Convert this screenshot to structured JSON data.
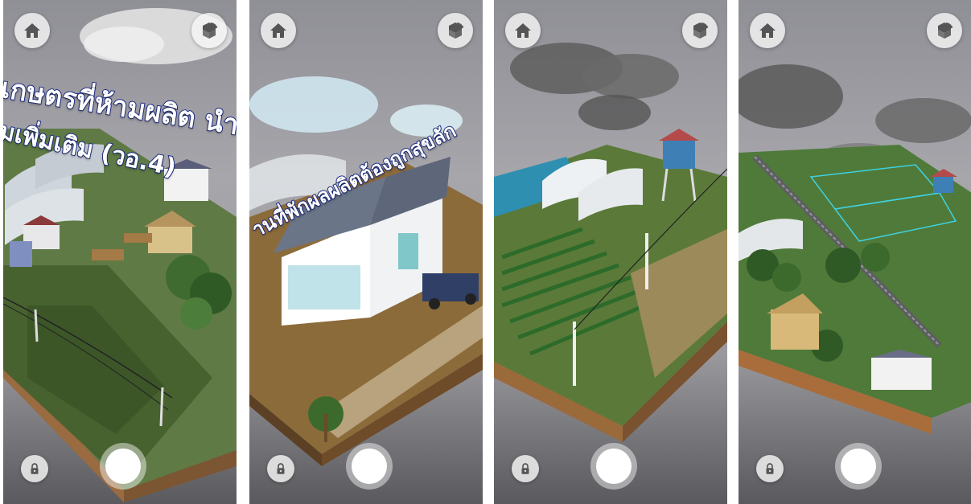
{
  "panels": [
    {
      "id": "p1",
      "overlay_lines": [
        "เกษตรที่ห้ามผลิต นำ",
        "มเพิ่มเติม (วอ.4)"
      ],
      "icons": {
        "home": "home-icon",
        "rotate": "rotate-3d-icon",
        "lock": "lock-icon"
      }
    },
    {
      "id": "p2",
      "overlay_lines": [
        "านที่พักผลผลิตต้องถูกสุขลัก"
      ],
      "icons": {
        "home": "home-icon",
        "rotate": "rotate-3d-icon",
        "lock": "lock-icon"
      }
    },
    {
      "id": "p3",
      "overlay_lines": [],
      "icons": {
        "home": "home-icon",
        "rotate": "rotate-3d-icon",
        "lock": "lock-icon"
      }
    },
    {
      "id": "p4",
      "overlay_lines": [],
      "icons": {
        "home": "home-icon",
        "rotate": "rotate-3d-icon",
        "lock": "lock-icon"
      }
    }
  ],
  "colors": {
    "overlay_text_fill": "#ffffff",
    "overlay_text_stroke": "#1e2f8a",
    "button_bg": "#f5f5f5",
    "icon": "#555555"
  }
}
